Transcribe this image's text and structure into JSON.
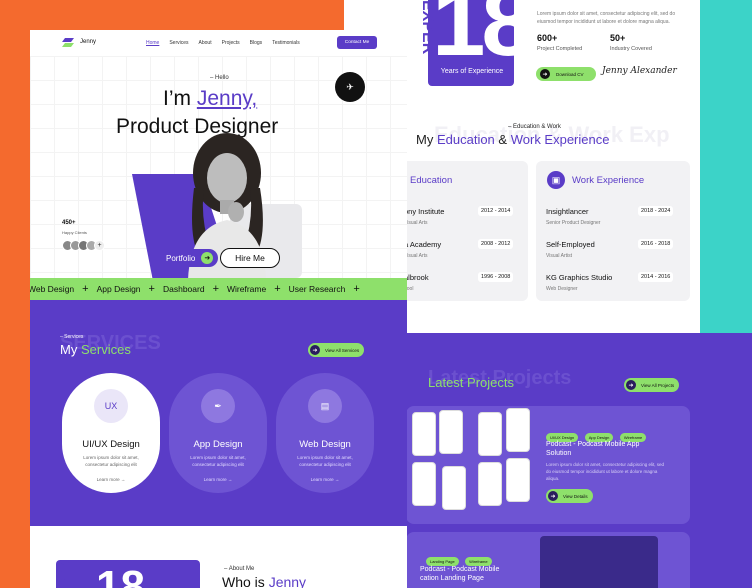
{
  "colors": {
    "brand": "#5a3cc7",
    "accent": "#8ee06b",
    "orange_bg": "#f46a2e",
    "teal_bg": "#3cd3c8"
  },
  "nav": {
    "logo_text": "Jenny",
    "links": [
      "Home",
      "Services",
      "About",
      "Projects",
      "Blogs",
      "Testimonials"
    ],
    "contact_button": "Contact Me"
  },
  "hero": {
    "hello": "Hello",
    "greeting_prefix": "I’m",
    "name": "Jenny,",
    "role": "Product Designer",
    "badge_icon": "hire-me-badge-icon",
    "happy_count": "450+",
    "happy_label": "Happy Clients",
    "portfolio_button": "Portfolio",
    "hire_button": "Hire Me"
  },
  "ticker": [
    "Web Design",
    "App Design",
    "Dashboard",
    "Wireframe",
    "User Research"
  ],
  "services": {
    "subtitle": "Services",
    "title_prefix": "My",
    "title_highlight": "Services",
    "watermark": "SERVICES",
    "view_all": "View All Services",
    "items": [
      {
        "name": "UI/UX Design",
        "icon": "ux-icon",
        "desc": "Lorem ipsum dolor sit amet, consectetur adipiscing elit",
        "link": "Learn more"
      },
      {
        "name": "App Design",
        "icon": "pen-tool-icon",
        "desc": "Lorem ipsum dolor sit amet, consectetur adipiscing elit",
        "link": "Learn more"
      },
      {
        "name": "Web Design",
        "icon": "layout-icon",
        "desc": "Lorem ipsum dolor sit amet, consectetur adipiscing elit",
        "link": "Learn more"
      }
    ]
  },
  "about": {
    "subtitle": "About Me",
    "title_prefix": "Who is",
    "title_name": "Jenny"
  },
  "experience": {
    "big_number": "18",
    "years_label": "Years of Experience",
    "vertical_label": "EXPER",
    "intro": "Lorem ipsum dolor sit amet, consectetur adipiscing elit, sed do eiusmod tempor incididunt ut labore et dolore magna aliqua.",
    "stat1_value": "600+",
    "stat1_label": "Project Completed",
    "stat2_value": "50+",
    "stat2_label": "Industry Covered",
    "cv_button": "Download CV",
    "signature": "Jenny Alexander"
  },
  "education": {
    "subtitle": "Education & Work",
    "title_prefix": "My",
    "title_a": "Education",
    "amp": "&",
    "title_b": "Work Experience",
    "watermark": "Education & Work Exp",
    "edu_head": "Education",
    "work_head": "Work Experience",
    "edu_items": [
      {
        "name": "ony Institute",
        "sub": "Visual Arts",
        "years": "2012 - 2014"
      },
      {
        "name": "a Academy",
        "sub": "Visual Arts",
        "years": "2008 - 2012"
      },
      {
        "name": "albrook",
        "sub": "hool",
        "years": "1996 - 2008"
      }
    ],
    "work_items": [
      {
        "name": "Insightlancer",
        "sub": "Senior Product Designer",
        "years": "2018 - 2024"
      },
      {
        "name": "Self-Employed",
        "sub": "Visual Artist",
        "years": "2016 - 2018"
      },
      {
        "name": "KG Graphics Studio",
        "sub": "Web Designer",
        "years": "2014 - 2016"
      }
    ]
  },
  "projects": {
    "title": "Latest Projects",
    "watermark": "Latest Projects",
    "view_all": "View All Projects",
    "p1_tags": [
      "UI/UX Design",
      "App Design",
      "Wireframe"
    ],
    "p1_title": "Podcast - Podcast Mobile App Solution",
    "p1_desc": "Lorem ipsum dolor sit amet, consectetur adipiscing elit, sed do eiusmod tempor incididunt ut labore et dolore magna aliqua.",
    "p1_button": "View Details",
    "p2_tags": [
      "Landing Page",
      "Wireframe"
    ],
    "p2_title": "Podcast - Podcast Mobile",
    "p2_title2": "cation Landing Page"
  }
}
